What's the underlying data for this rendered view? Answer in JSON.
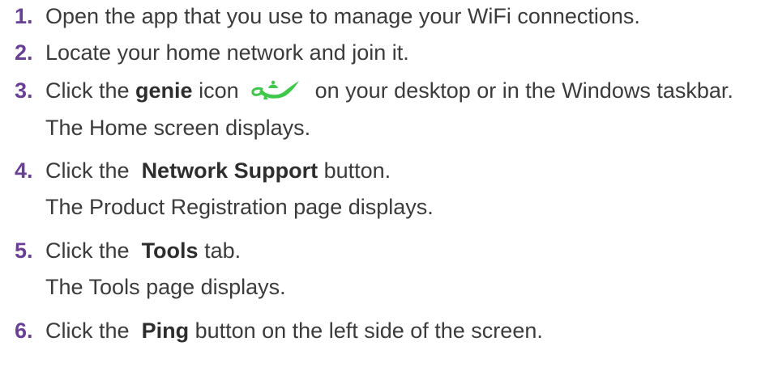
{
  "steps": [
    {
      "number": "1.",
      "text": "Open the app that you use to manage your WiFi connections."
    },
    {
      "number": "2.",
      "text": "Locate your home network and join it."
    },
    {
      "number": "3.",
      "pre": "Click the ",
      "bold": "genie",
      "mid": " icon",
      "icon": "genie-lamp-icon",
      "post": "on your desktop or in the Windows taskbar.",
      "result": "The Home screen displays."
    },
    {
      "number": "4.",
      "pre": "Click the ",
      "bold": "Network Support",
      "post": " button.",
      "result": "The Product Registration page displays."
    },
    {
      "number": "5.",
      "pre": "Click the ",
      "bold": "Tools",
      "post": " tab.",
      "result": "The Tools page displays."
    },
    {
      "number": "6.",
      "pre": "Click the ",
      "bold": "Ping",
      "post": " button on the left side of the screen."
    }
  ],
  "colors": {
    "number": "#6a3f96",
    "text": "#3b3b3b",
    "icon": "#3fc84a"
  }
}
